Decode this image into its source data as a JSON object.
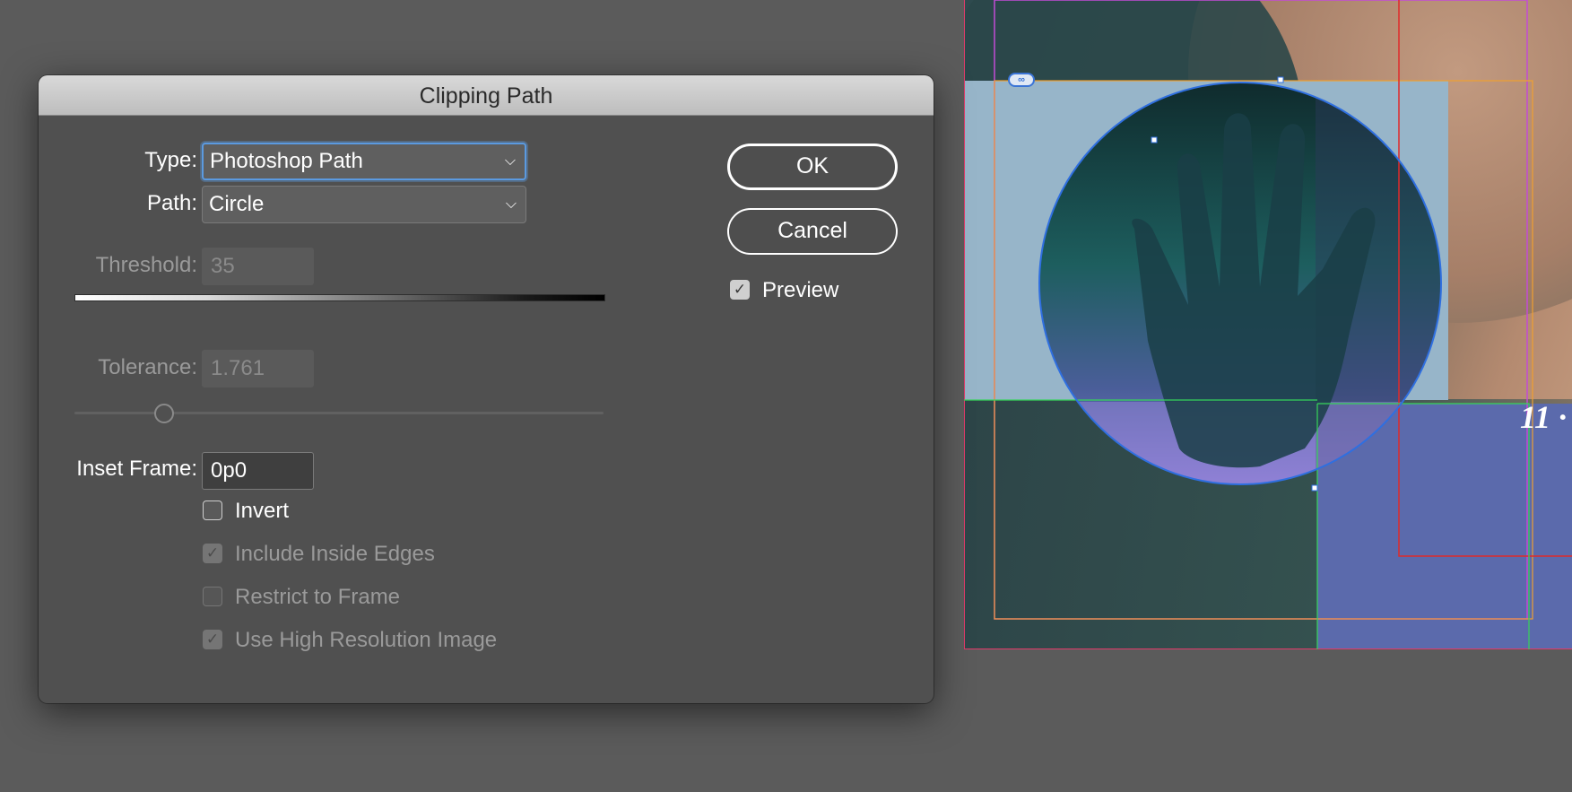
{
  "dialog": {
    "title": "Clipping Path",
    "type": {
      "label": "Type:",
      "value": "Photoshop Path"
    },
    "path": {
      "label": "Path:",
      "value": "Circle"
    },
    "threshold": {
      "label": "Threshold:",
      "value": "35"
    },
    "tolerance": {
      "label": "Tolerance:",
      "value": "1.761",
      "slider_fraction": 0.17
    },
    "inset_frame": {
      "label": "Inset Frame:",
      "value": "0p0"
    },
    "checkboxes": [
      {
        "label": "Invert",
        "checked": false,
        "enabled": true
      },
      {
        "label": "Include Inside Edges",
        "checked": true,
        "enabled": false
      },
      {
        "label": "Restrict to Frame",
        "checked": false,
        "enabled": false
      },
      {
        "label": "Use High Resolution Image",
        "checked": true,
        "enabled": false
      }
    ],
    "buttons": {
      "ok": "OK",
      "cancel": "Cancel"
    },
    "preview": {
      "label": "Preview",
      "checked": true
    }
  },
  "canvas": {
    "page_number_text": "11 ·",
    "icons": {
      "link": "link-icon",
      "chevron": "chevron-down-icon",
      "check": "checkmark-icon"
    }
  },
  "colors": {
    "focus_ring": "#5b9ae0",
    "frame_light_blue": "#97b5c9",
    "frame_purple": "#5b6aac",
    "guide_magenta": "#c34bd6",
    "guide_red": "#e02a2a",
    "guide_orange": "#f0a030",
    "guide_green": "#37d55a",
    "path_blue": "#2f6fe0"
  }
}
